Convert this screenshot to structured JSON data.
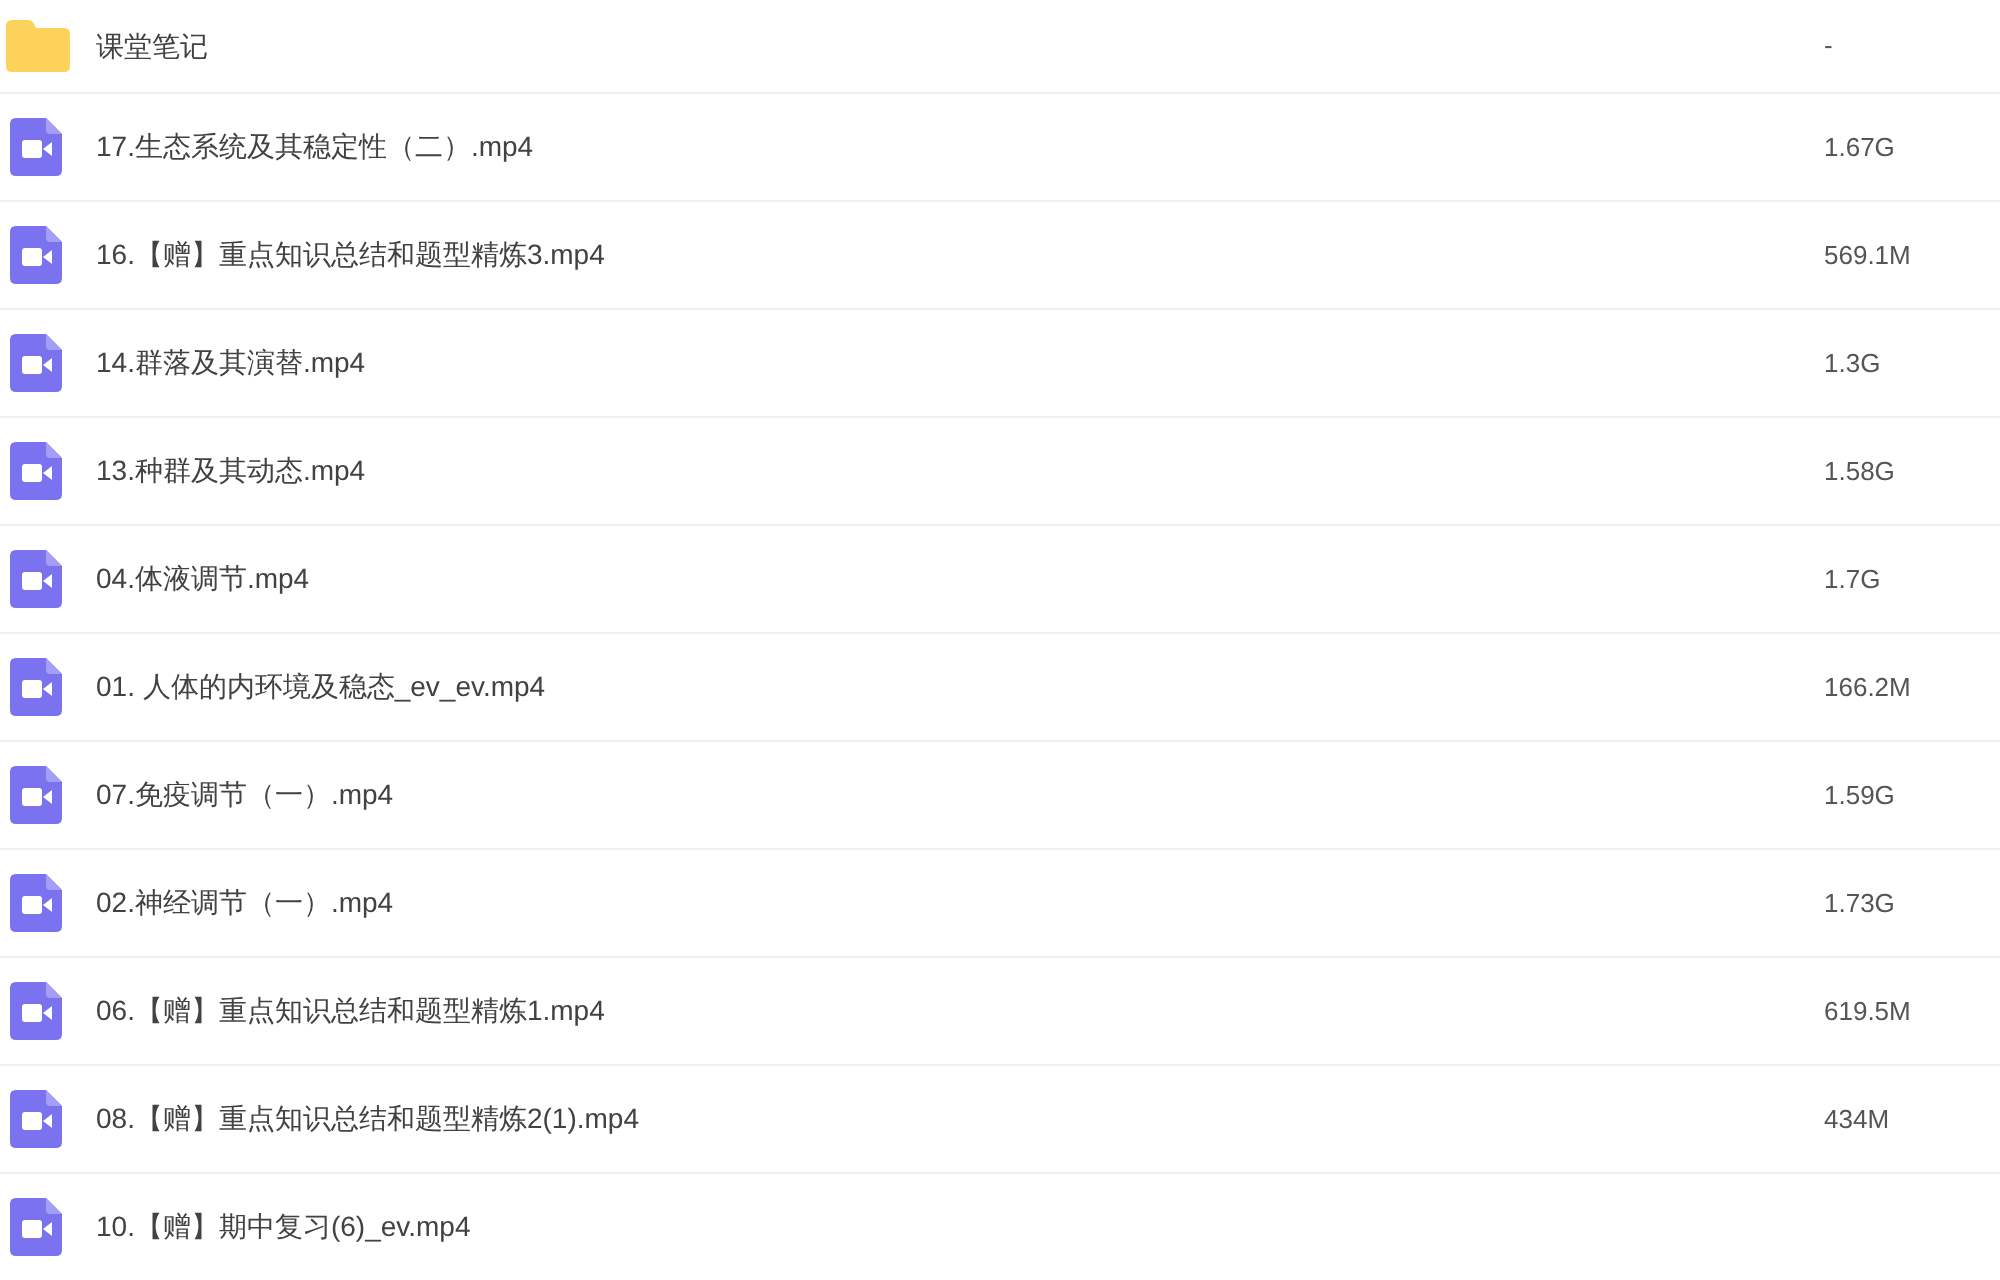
{
  "files": [
    {
      "kind": "folder",
      "name": "课堂笔记",
      "size": "-"
    },
    {
      "kind": "video",
      "name": "17.生态系统及其稳定性（二）.mp4",
      "size": "1.67G"
    },
    {
      "kind": "video",
      "name": "16.【赠】重点知识总结和题型精炼3.mp4",
      "size": "569.1M"
    },
    {
      "kind": "video",
      "name": "14.群落及其演替.mp4",
      "size": "1.3G"
    },
    {
      "kind": "video",
      "name": "13.种群及其动态.mp4",
      "size": "1.58G"
    },
    {
      "kind": "video",
      "name": "04.体液调节.mp4",
      "size": "1.7G"
    },
    {
      "kind": "video",
      "name": "01. 人体的内环境及稳态_ev_ev.mp4",
      "size": "166.2M"
    },
    {
      "kind": "video",
      "name": "07.免疫调节（一）.mp4",
      "size": "1.59G"
    },
    {
      "kind": "video",
      "name": "02.神经调节（一）.mp4",
      "size": "1.73G"
    },
    {
      "kind": "video",
      "name": "06.【赠】重点知识总结和题型精炼1.mp4",
      "size": "619.5M"
    },
    {
      "kind": "video",
      "name": "08.【赠】重点知识总结和题型精炼2(1).mp4",
      "size": "434M"
    },
    {
      "kind": "video",
      "name": "10.【赠】期中复习(6)_ev.mp4"
    }
  ]
}
